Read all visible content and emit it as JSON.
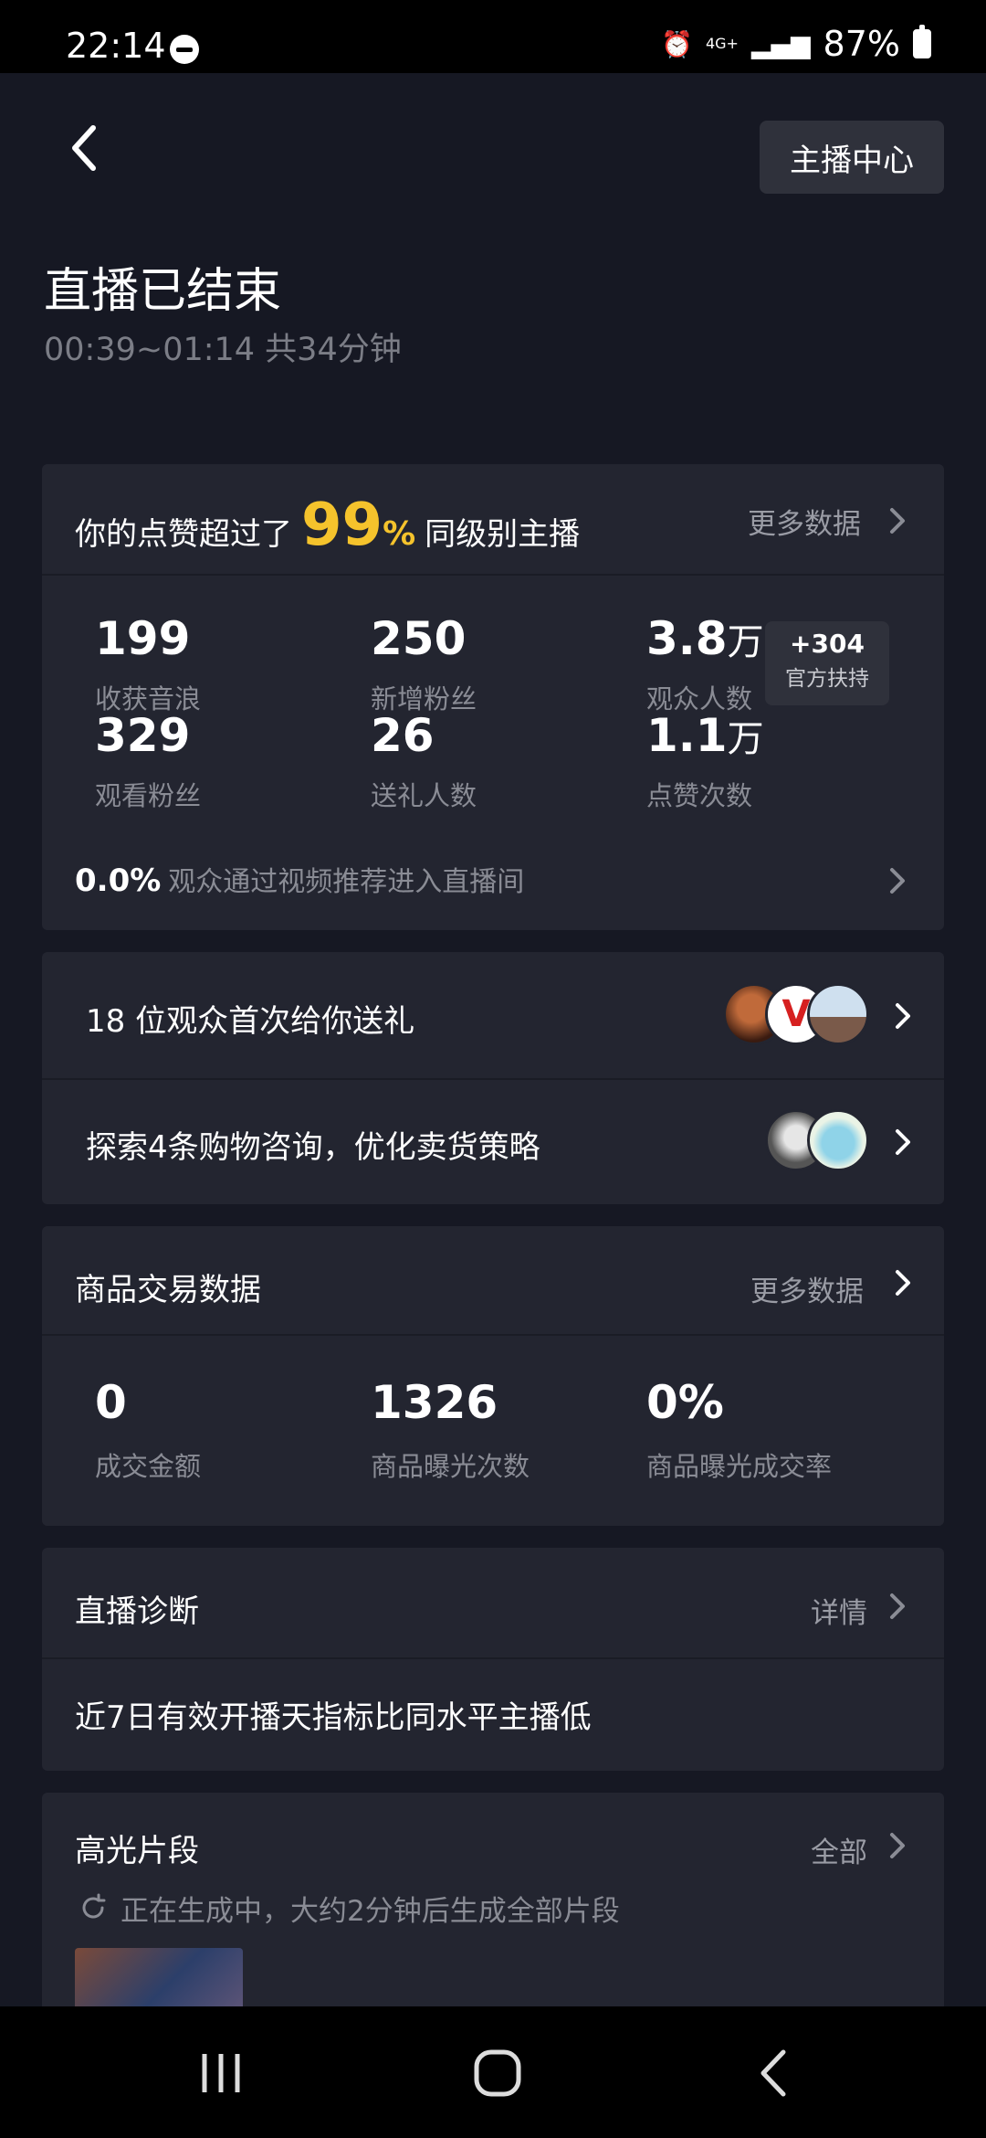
{
  "status_bar": {
    "time": "22:14",
    "network": "4G+",
    "battery": "87%"
  },
  "header": {
    "anchor_center_label": "主播中心"
  },
  "summary": {
    "title": "直播已结束",
    "subtitle": "00:39~01:14 共34分钟"
  },
  "likes_card": {
    "prefix": "你的点赞超过了",
    "percent": "99",
    "percent_sign": "%",
    "suffix": "同级别主播",
    "more_label": "更多数据",
    "stats": [
      {
        "value": "199",
        "label": "收获音浪"
      },
      {
        "value": "250",
        "label": "新增粉丝"
      },
      {
        "value": "3.8",
        "unit": "万",
        "label": "观众人数"
      },
      {
        "value": "329",
        "label": "观看粉丝"
      },
      {
        "value": "26",
        "label": "送礼人数"
      },
      {
        "value": "1.1",
        "unit": "万",
        "label": "点赞次数"
      }
    ],
    "badge": {
      "value": "+304",
      "label": "官方扶持"
    },
    "recommend": {
      "value": "0.0%",
      "text": "观众通过视频推荐进入直播间"
    }
  },
  "gift_card": {
    "first_gift_text": "18 位观众首次给你送礼",
    "shopping_text": "探索4条购物咨询，优化卖货策略"
  },
  "commerce_card": {
    "title": "商品交易数据",
    "more_label": "更多数据",
    "stats": [
      {
        "value": "0",
        "label": "成交金额"
      },
      {
        "value": "1326",
        "label": "商品曝光次数"
      },
      {
        "value": "0%",
        "label": "商品曝光成交率"
      }
    ]
  },
  "diagnosis_card": {
    "title": "直播诊断",
    "detail_label": "详情",
    "text": "近7日有效开播天指标比同水平主播低"
  },
  "highlight_card": {
    "title": "高光片段",
    "all_label": "全部",
    "status_text": "正在生成中，大约2分钟后生成全部片段"
  },
  "colors": {
    "background": "#161823",
    "card": "#232530",
    "accent": "#f5c32c",
    "muted": "#8a8c95"
  },
  "icons": [
    "back-icon",
    "chevron-right-icon",
    "refresh-icon",
    "recent-apps-icon",
    "home-icon",
    "nav-back-icon"
  ]
}
